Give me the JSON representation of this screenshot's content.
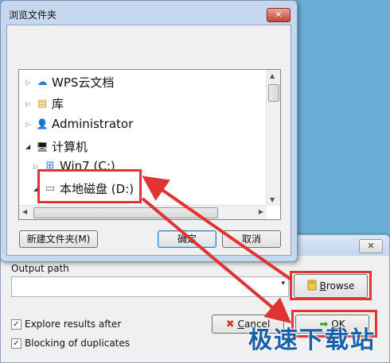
{
  "bg_window": {
    "close": "✕"
  },
  "output": {
    "label": "Output path",
    "value": "",
    "dropdown_arrow": "▾"
  },
  "browse": {
    "label_prefix": "",
    "underlined": "B",
    "label_rest": "rowse",
    "icon": "folder-icon"
  },
  "cancel": {
    "icon": "✖",
    "underlined": "C",
    "label_rest": "ancel"
  },
  "ok": {
    "icon": "➡",
    "underlined": "O",
    "label_rest": "K"
  },
  "checkboxes": [
    {
      "label": "Explore results after",
      "checked": true
    },
    {
      "label": "Blocking of duplicates",
      "checked": true
    }
  ],
  "dialog": {
    "title": "浏览文件夹",
    "close": "✕",
    "tree": [
      {
        "label": "WPS云文档",
        "icon": "☁",
        "icon_name": "cloud-icon",
        "expander": "▷"
      },
      {
        "label": "库",
        "icon": "▤",
        "icon_name": "library-icon",
        "expander": "▷"
      },
      {
        "label": "Administrator",
        "icon": "👤",
        "icon_name": "user-icon",
        "expander": "▷"
      },
      {
        "label": "计算机",
        "icon": "🖥",
        "icon_name": "computer-icon",
        "expander": "◢"
      },
      {
        "label": "Win7 (C:)",
        "icon": "⊞",
        "icon_name": "windows-drive-icon",
        "expander": "▷"
      },
      {
        "label": "本地磁盘 (D:)",
        "icon": "▭",
        "icon_name": "disk-drive-icon",
        "expander": "◢"
      }
    ],
    "new_folder": "新建文件夹(M)",
    "ok": "确定",
    "cancel": "取消"
  },
  "watermark": "极速下载站",
  "colors": {
    "highlight": "#e03333",
    "dialog_frame": "#c5d8ef"
  }
}
